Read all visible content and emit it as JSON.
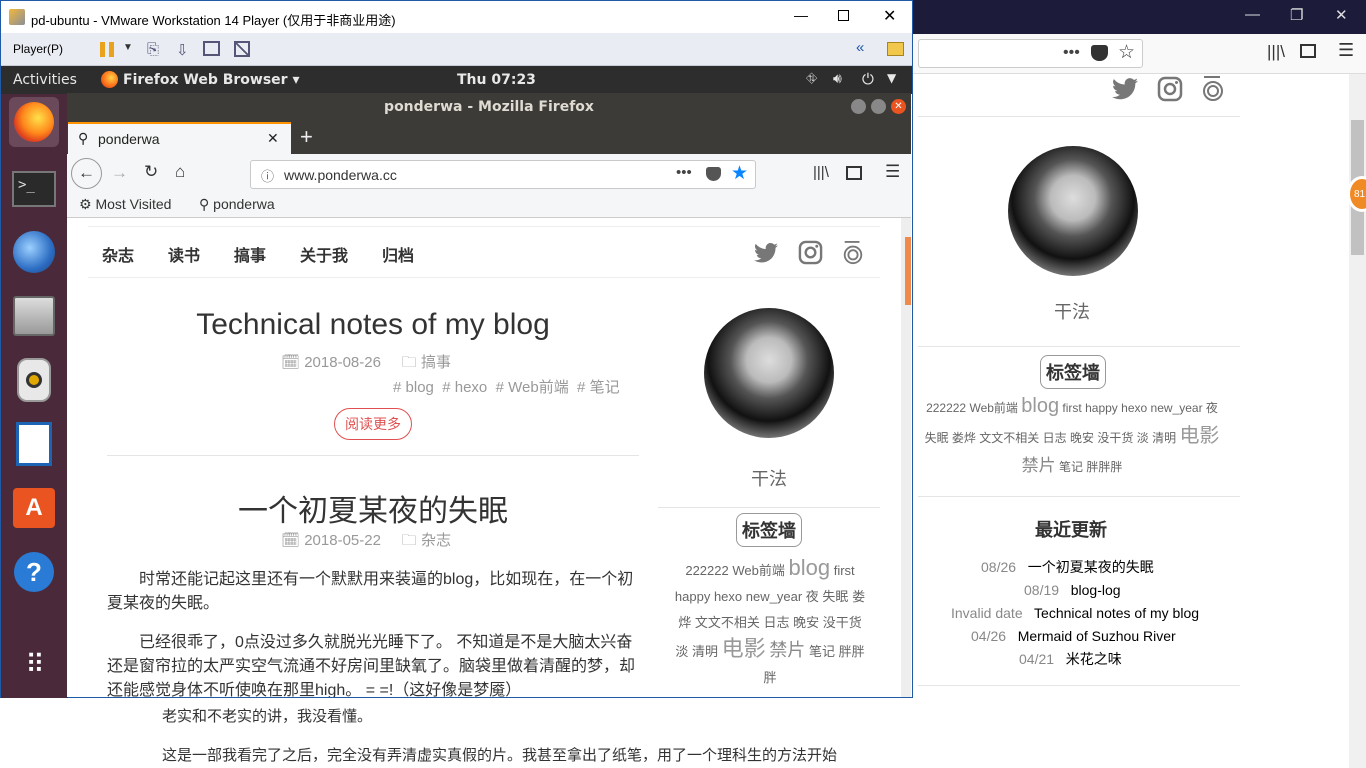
{
  "vmware": {
    "title": "pd-ubuntu - VMware Workstation 14 Player (仅用于非商业用途)",
    "player_menu": "Player(P)"
  },
  "gnome": {
    "activities": "Activities",
    "app_menu": "Firefox Web Browser",
    "clock": "Thu 07:23"
  },
  "firefox": {
    "window_title": "ponderwa - Mozilla Firefox",
    "tab_label": "ponderwa",
    "url": "www.ponderwa.cc",
    "bookmarks": [
      "Most Visited",
      "ponderwa"
    ]
  },
  "blog": {
    "nav": [
      "杂志",
      "读书",
      "搞事",
      "关于我",
      "归档"
    ],
    "posts": [
      {
        "title": "Technical notes of my blog",
        "date": "2018-08-26",
        "category": "搞事",
        "tags": [
          "blog",
          "hexo",
          "Web前端",
          "笔记"
        ],
        "read_more": "阅读更多"
      },
      {
        "title": "一个初夏某夜的失眠",
        "date": "2018-05-22",
        "category": "杂志",
        "paragraphs": [
          "时常还能记起这里还有一个默默用来装逼的blog，比如现在，在一个初夏某夜的失眠。",
          "已经很乖了，0点没过多久就脱光光睡下了。 不知道是不是大脑太兴奋还是窗帘拉的太严实空气流通不好房间里缺氧了。脑袋里做着清醒的梦，却还能感觉身体不听使唤在那里high。 = =!（这好像是梦魇）"
        ]
      }
    ],
    "sidebar": {
      "name": "干法",
      "tagwall_title": "标签墙",
      "tagcloud": [
        "222222",
        "Web前端",
        "blog",
        "first",
        "happy",
        "hexo",
        "new_year",
        "夜",
        "失眠",
        "娄烨",
        "文文不相关",
        "日志",
        "晚安",
        "没干货",
        "淡",
        "清明",
        "电影",
        "禁片",
        "笔记",
        "胖胖胖"
      ]
    }
  },
  "host": {
    "recent_title": "最近更新",
    "recent": [
      {
        "date": "08/26",
        "title": "一个初夏某夜的失眠"
      },
      {
        "date": "08/19",
        "title": "blog-log"
      },
      {
        "date": "Invalid date",
        "title": "Technical notes of my blog"
      },
      {
        "date": "04/26",
        "title": "Mermaid of Suzhou River"
      },
      {
        "date": "04/21",
        "title": "米花之味"
      }
    ],
    "body_lines": [
      "老实和不老实的讲，我没看懂。",
      "这是一部我看完了之后，完全没有弄清虚实真假的片。我甚至拿出了纸笔，用了一个理科生的方法开始"
    ],
    "badge": "81"
  }
}
